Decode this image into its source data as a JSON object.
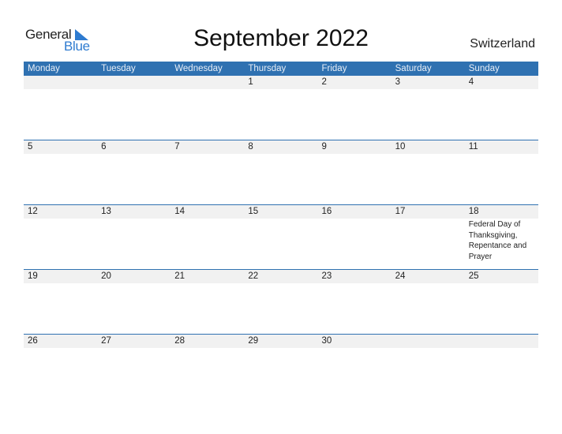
{
  "logo": {
    "word1": "General",
    "word2": "Blue"
  },
  "header": {
    "title": "September 2022",
    "country": "Switzerland"
  },
  "colors": {
    "accent": "#2f71b1",
    "strip": "#f1f1f1",
    "logo_blue": "#2e7bd0"
  },
  "calendar": {
    "weekdays": [
      "Monday",
      "Tuesday",
      "Wednesday",
      "Thursday",
      "Friday",
      "Saturday",
      "Sunday"
    ],
    "weeks": [
      {
        "days": [
          "",
          "",
          "",
          "1",
          "2",
          "3",
          "4"
        ],
        "events": [
          "",
          "",
          "",
          "",
          "",
          "",
          ""
        ]
      },
      {
        "days": [
          "5",
          "6",
          "7",
          "8",
          "9",
          "10",
          "11"
        ],
        "events": [
          "",
          "",
          "",
          "",
          "",
          "",
          ""
        ]
      },
      {
        "days": [
          "12",
          "13",
          "14",
          "15",
          "16",
          "17",
          "18"
        ],
        "events": [
          "",
          "",
          "",
          "",
          "",
          "",
          "Federal Day of Thanksgiving, Repentance and Prayer"
        ]
      },
      {
        "days": [
          "19",
          "20",
          "21",
          "22",
          "23",
          "24",
          "25"
        ],
        "events": [
          "",
          "",
          "",
          "",
          "",
          "",
          ""
        ]
      },
      {
        "days": [
          "26",
          "27",
          "28",
          "29",
          "30",
          "",
          ""
        ],
        "events": [
          "",
          "",
          "",
          "",
          "",
          "",
          ""
        ]
      }
    ]
  }
}
